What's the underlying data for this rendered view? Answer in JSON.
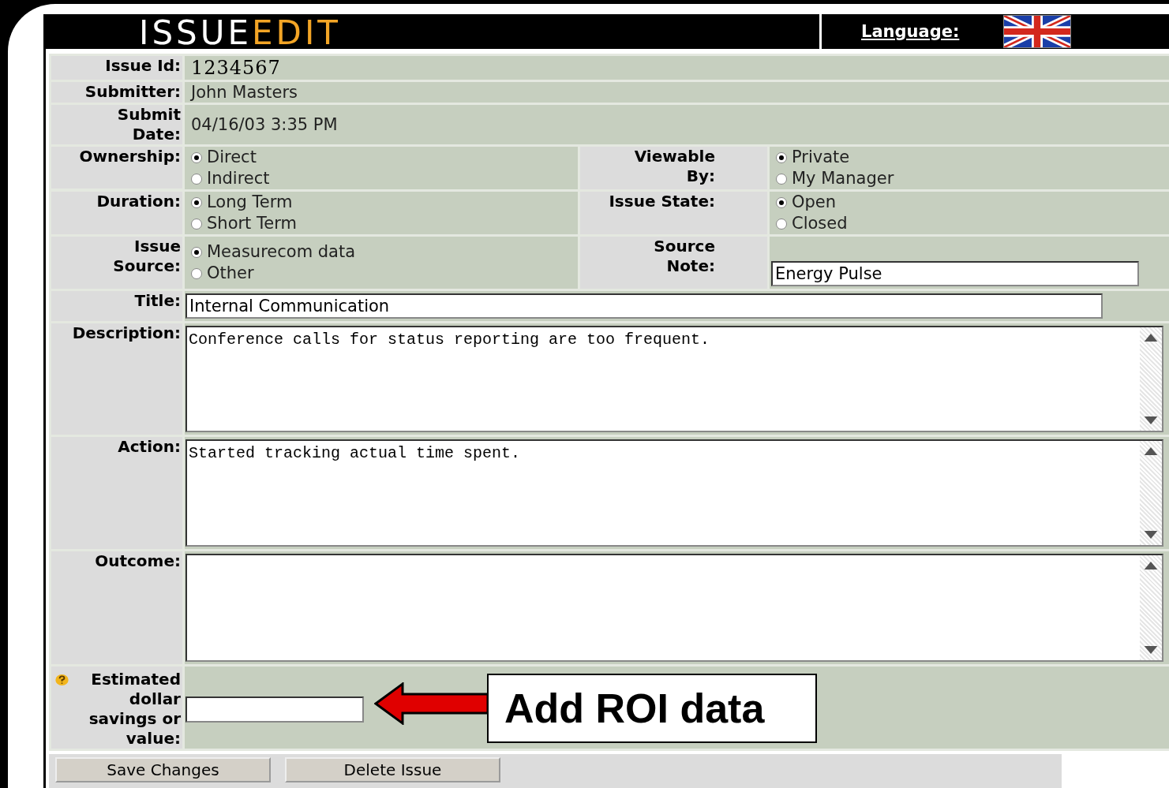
{
  "header": {
    "title_light": "ISSUE",
    "title_accent": "EDIT",
    "language_link": "Language:"
  },
  "info_rows": [
    {
      "label": "Issue Id:",
      "value": "1234567",
      "kind": "id"
    },
    {
      "label": "Submitter:",
      "value": "John Masters",
      "kind": "text"
    },
    {
      "label": "Submit\nDate:",
      "value": "04/16/03 3:35 PM",
      "kind": "text"
    }
  ],
  "option_rows": [
    {
      "left": {
        "label": "Ownership:",
        "options": [
          {
            "label": "Direct",
            "selected": true
          },
          {
            "label": "Indirect",
            "selected": false
          }
        ]
      },
      "right": {
        "label": "Viewable\nBy:",
        "kind": "radio",
        "options": [
          {
            "label": "Private",
            "selected": true
          },
          {
            "label": "My Manager",
            "selected": false
          }
        ]
      }
    },
    {
      "left": {
        "label": "Duration:",
        "options": [
          {
            "label": "Long Term",
            "selected": true
          },
          {
            "label": "Short Term",
            "selected": false
          }
        ]
      },
      "right": {
        "label": "Issue State:",
        "kind": "radio",
        "options": [
          {
            "label": "Open",
            "selected": true
          },
          {
            "label": "Closed",
            "selected": false
          }
        ]
      }
    },
    {
      "left": {
        "label": "Issue\nSource:",
        "options": [
          {
            "label": "Measurecom data",
            "selected": true
          },
          {
            "label": "Other",
            "selected": false
          }
        ]
      },
      "right": {
        "label": "Source\nNote:",
        "kind": "input",
        "value": "Energy Pulse"
      }
    }
  ],
  "title_field": {
    "label": "Title:",
    "value": "Internal Communication"
  },
  "text_areas": [
    {
      "label": "Description:",
      "value": "Conference calls for status reporting are too frequent."
    },
    {
      "label": "Action:",
      "value": "Started tracking actual time spent."
    },
    {
      "label": "Outcome:"
    }
  ],
  "estimate": {
    "label": "Estimated\ndollar\nsavings or\nvalue:"
  },
  "callout": {
    "text": "Add ROI data"
  },
  "buttons": [
    "Save Changes",
    "Delete Issue"
  ]
}
